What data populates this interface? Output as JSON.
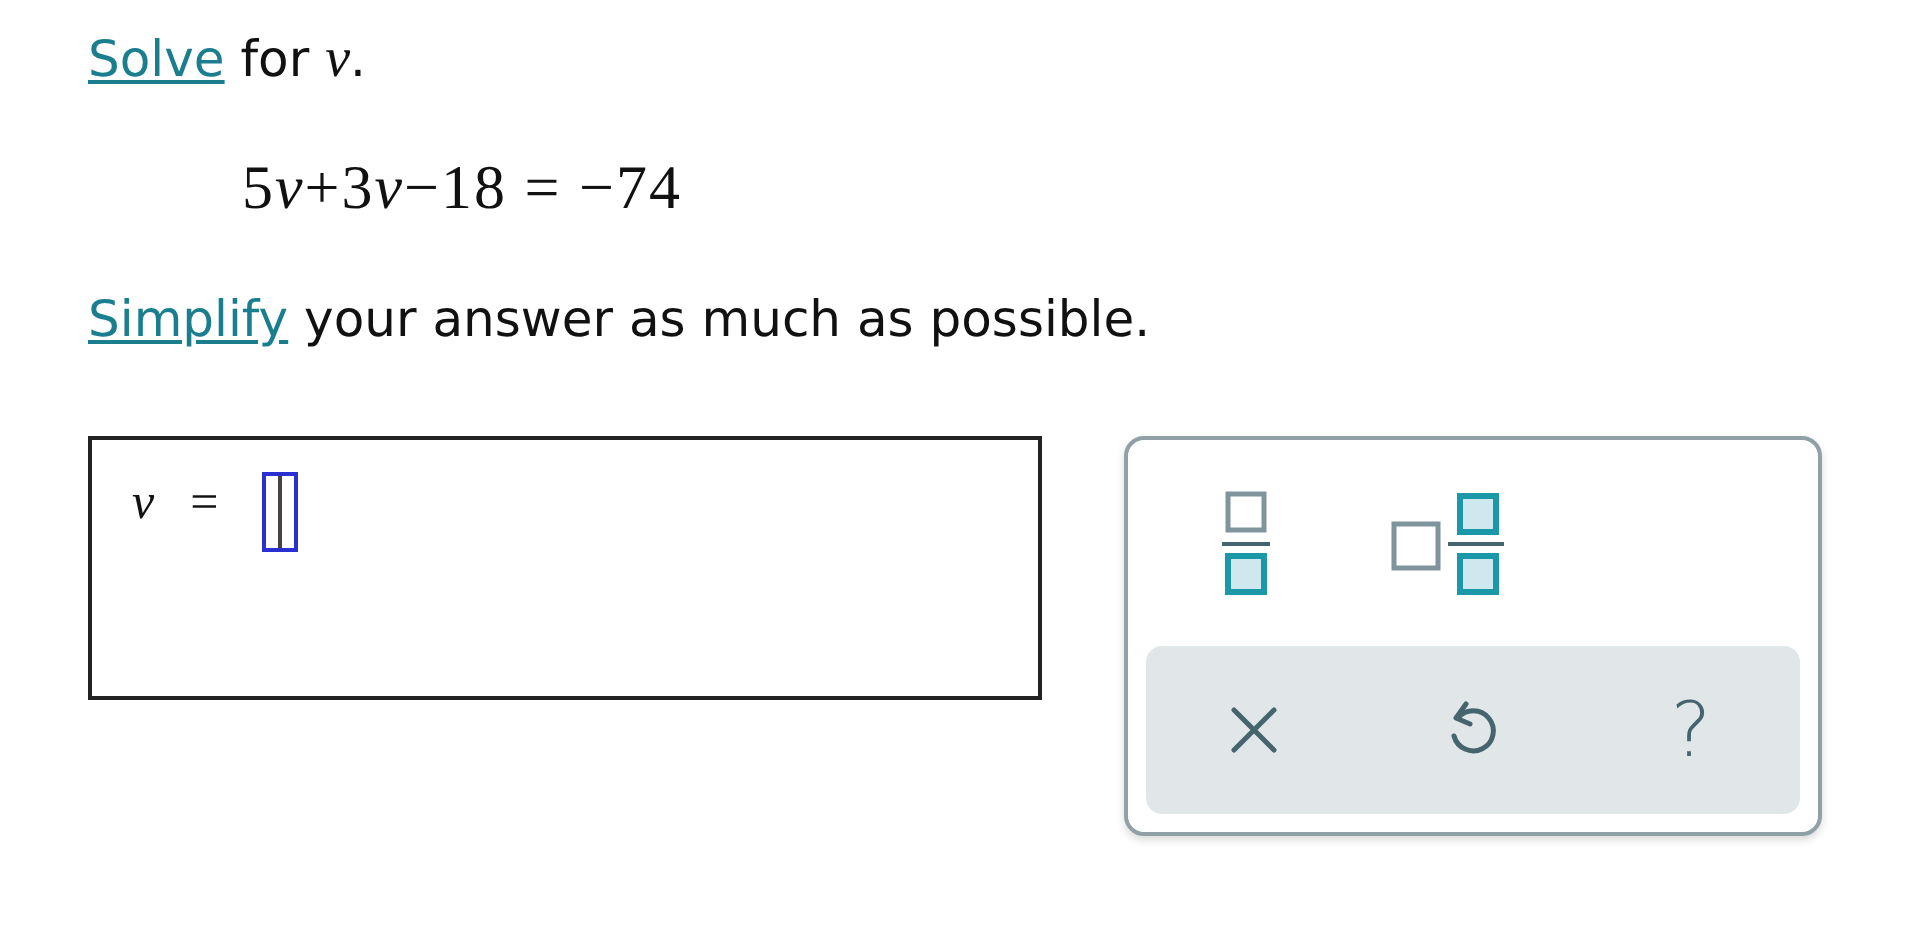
{
  "instruction": {
    "link": "Solve",
    "text": "for *v*."
  },
  "equation": [
    {
      "text": "5",
      "italic": false
    },
    {
      "text": "v",
      "italic": true
    },
    {
      "text": "+3",
      "italic": false
    },
    {
      "text": "v",
      "italic": true
    },
    {
      "text": "−18 = −74",
      "italic": false
    }
  ],
  "hint": {
    "link": "Simplify",
    "text": "your answer as much as possible."
  },
  "answer": {
    "variable": "v",
    "relation": "="
  },
  "keypad": {
    "templates": [
      {
        "kind": "fraction"
      },
      {
        "kind": "mixed"
      }
    ],
    "actions": [
      {
        "kind": "clear"
      },
      {
        "kind": "undo"
      },
      {
        "kind": "help",
        "glyph": "?"
      }
    ]
  }
}
